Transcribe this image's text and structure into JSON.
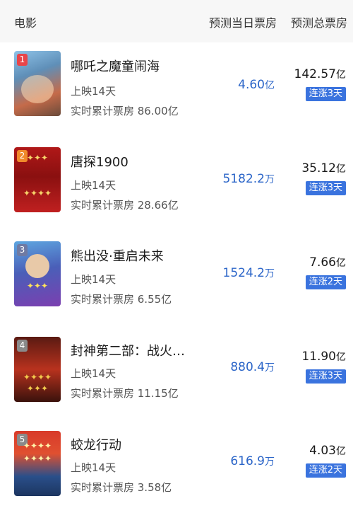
{
  "header": {
    "col_movie": "电影",
    "col_daily": "预测当日票房",
    "col_total": "预测总票房"
  },
  "movies": [
    {
      "rank": "1",
      "title": "哪吒之魔童闹海",
      "days": "上映14天",
      "cumulative": "实时累计票房 86.00亿",
      "daily_value": "4.60",
      "daily_unit": "亿",
      "total_value": "142.57",
      "total_unit": "亿",
      "streak": "连涨3天",
      "rank_color": "#e8454a"
    },
    {
      "rank": "2",
      "title": "唐探1900",
      "days": "上映14天",
      "cumulative": "实时累计票房 28.66亿",
      "daily_value": "5182.2",
      "daily_unit": "万",
      "total_value": "35.12",
      "total_unit": "亿",
      "streak": "连涨3天",
      "rank_color": "#f08a2b"
    },
    {
      "rank": "3",
      "title": "熊出没·重启未来",
      "days": "上映14天",
      "cumulative": "实时累计票房 6.55亿",
      "daily_value": "1524.2",
      "daily_unit": "万",
      "total_value": "7.66",
      "total_unit": "亿",
      "streak": "连涨2天",
      "rank_color": "#6f7aa3"
    },
    {
      "rank": "4",
      "title": "封神第二部：战火…",
      "days": "上映14天",
      "cumulative": "实时累计票房 11.15亿",
      "daily_value": "880.4",
      "daily_unit": "万",
      "total_value": "11.90",
      "total_unit": "亿",
      "streak": "连涨3天",
      "rank_color": "#8a8a8a"
    },
    {
      "rank": "5",
      "title": "蛟龙行动",
      "days": "上映14天",
      "cumulative": "实时累计票房 3.58亿",
      "daily_value": "616.9",
      "daily_unit": "万",
      "total_value": "4.03",
      "total_unit": "亿",
      "streak": "连涨2天",
      "rank_color": "#8a8a8a"
    }
  ]
}
